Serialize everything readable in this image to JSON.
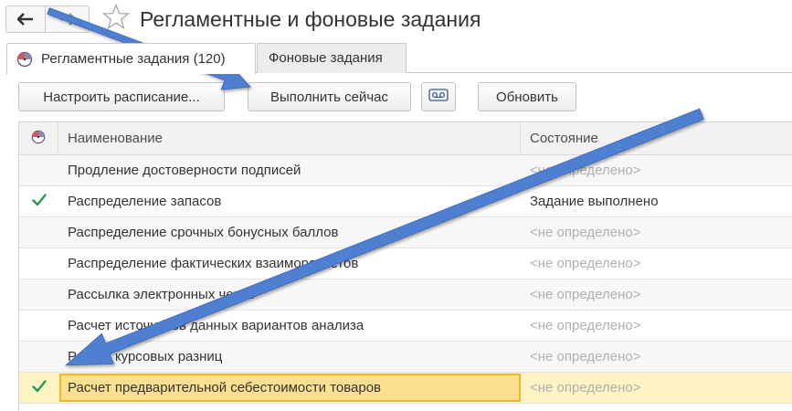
{
  "window": {
    "title": "Регламентные и фоновые задания",
    "back_icon": "arrow-left-icon",
    "forward_icon": "arrow-right-icon",
    "favorite_icon": "star-icon"
  },
  "tabs": [
    {
      "label": "Регламентные задания (120)",
      "active": true,
      "icon": "clock-icon"
    },
    {
      "label": "Фоновые задания",
      "active": false
    }
  ],
  "toolbar": {
    "schedule_label": "Настроить расписание...",
    "run_now_label": "Выполнить сейчас",
    "tape_icon": "cassette-icon",
    "refresh_label": "Обновить"
  },
  "table": {
    "columns": {
      "icon": "clock-icon",
      "name": "Наименование",
      "state": "Состояние"
    },
    "rows": [
      {
        "name": "Продление достоверности подписей",
        "state": "<не определено>",
        "done": false
      },
      {
        "name": "Распределение запасов",
        "state": "Задание выполнено",
        "done": true
      },
      {
        "name": "Распределение срочных бонусных баллов",
        "state": "<не определено>",
        "done": false
      },
      {
        "name": "Распределение фактических взаиморасчетов",
        "state": "<не определено>",
        "done": false
      },
      {
        "name": "Рассылка электронных чеков",
        "state": "<не определено>",
        "done": false
      },
      {
        "name": "Расчет источников данных вариантов анализа",
        "state": "<не определено>",
        "done": false
      },
      {
        "name": "Расчет курсовых разниц",
        "state": "<не определено>",
        "done": false
      },
      {
        "name": "Расчет предварительной себестоимости товаров",
        "state": "<не определено>",
        "done": true,
        "selected": true
      }
    ]
  },
  "colors": {
    "arrow": "#4f7fd0",
    "check": "#1f9a55",
    "selected_row": "#fdf3c4",
    "selected_cell": "#fce08f",
    "selected_border": "#f2b824"
  }
}
